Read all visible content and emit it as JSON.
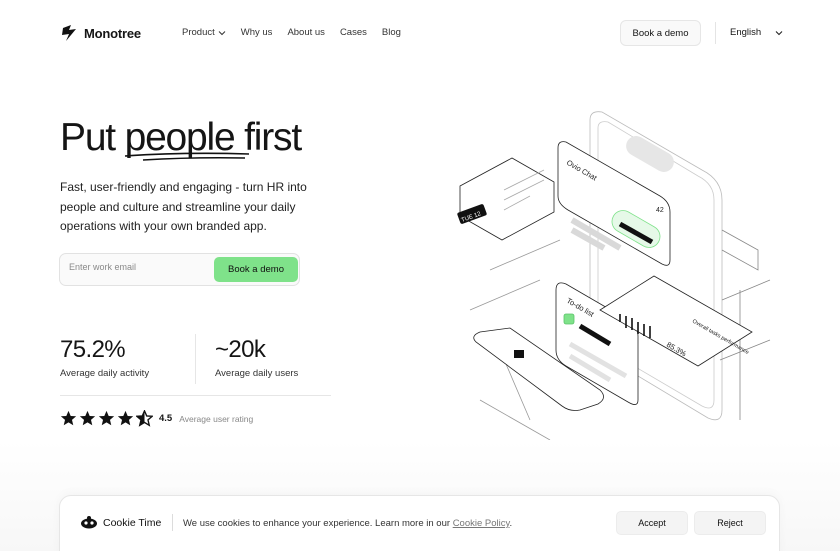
{
  "nav": {
    "brand": "Monotree",
    "items": [
      "Product",
      "Why us",
      "About us",
      "Cases",
      "Blog"
    ],
    "cta": "Book a demo",
    "language": "English"
  },
  "hero": {
    "title_before": "Put ",
    "title_emph": "people",
    "title_after": " first",
    "subtitle": "Fast, user-friendly and engaging - turn HR into people and culture and streamline your daily operations with your own branded app.",
    "email_placeholder": "Enter work email",
    "cta": "Book a demo"
  },
  "stats": [
    {
      "value": "75.2%",
      "label": "Average daily activity"
    },
    {
      "value": "~20k",
      "label": "Average daily users"
    }
  ],
  "rating": {
    "value": "4.5",
    "label": "Average user rating",
    "stars": 4.5
  },
  "illustration": {
    "chat_title": "Ovio Chat",
    "chat_count": "42",
    "date_badge": "TUE 12",
    "todo_title": "To-do list",
    "perf_label": "Overall tasks performance",
    "perf_value": "85.3%",
    "accent": "#7fe28a"
  },
  "cookie": {
    "title": "Cookie Time",
    "text": "We use cookies to enhance your experience. Learn more in our ",
    "link": "Cookie Policy",
    "text_end": ".",
    "accept": "Accept",
    "reject": "Reject"
  }
}
